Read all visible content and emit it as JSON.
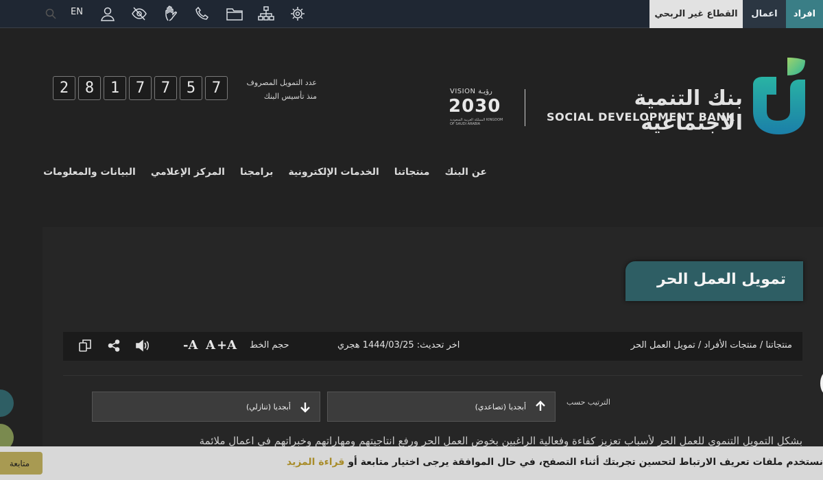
{
  "topbar": {
    "language": "EN",
    "segments": {
      "individuals": "افراد",
      "business": "اعمال",
      "informal": "القطاع غير الربحي"
    },
    "icons": [
      "search-icon",
      "user-icon",
      "eye-slash-icon",
      "sign-language-icon",
      "phone-icon",
      "folder-icon",
      "sitemap-icon",
      "settings-icon"
    ]
  },
  "header": {
    "counter_label_line1": "عدد التمويل المصروف",
    "counter_label_line2": "منذ تأسيس البنك",
    "counter_digits": [
      "2",
      "8",
      "1",
      "7",
      "7",
      "5",
      "7"
    ],
    "vision_top": "VISION رؤيـة",
    "vision_number": "2030",
    "vision_sub": "المملكة العربية السعودية KINGDOM OF SAUDI ARABIA",
    "bank_name_ar": "بنك التنمية الاجتماعية",
    "bank_name_en": "SOCIAL DEVELOPMENT BANK"
  },
  "nav": [
    "عن البنك",
    "منتجاتنا",
    "الخدمات الإلكترونية",
    "برامجنا",
    "المركز الإعلامي",
    "البيانات والمعلومات"
  ],
  "page": {
    "title": "تمويل العمل الحر",
    "breadcrumb": "منتجاتنا / منتجات الأفراد / تمويل العمل الحر",
    "updated": "اخر تحديث: 1444/03/25 هجري",
    "font_size_label": "حجم الخط",
    "font_plus": "+A",
    "font_normal": "A",
    "font_minus": "-A",
    "sort_label": "الترتيب حسب",
    "sort_asc": "أبجديا (تصاعدي)",
    "sort_desc": "أبجديا (تنازلي)",
    "body_text": "بشكل التمويل التنموي للعمل الحر لأسباب تعزيز كفاءة وفعالية الراغبين بخوض العمل الحر ورفع انتاجيتهم ومهاراتهم وخبراتهم في اعمال ملائمة"
  },
  "cookie": {
    "text": "نستخدم ملفات تعريف الارتباط لتحسين تجربتك أثناء التصفح، في حال الموافقة يرجى اختيار متابعة أو",
    "link": "قراءة المزيد",
    "button": "متابعة"
  },
  "colors": {
    "accent": "#3a7e86",
    "title_bg": "#2e5e64",
    "background": "#222222",
    "cookie_bg": "#d8d8d8"
  }
}
